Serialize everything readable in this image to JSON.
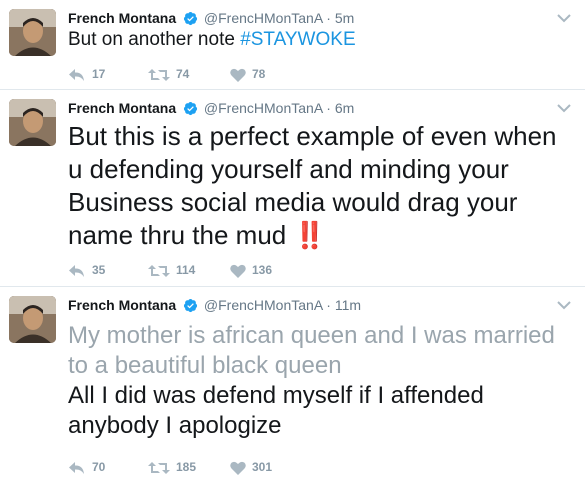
{
  "tweets": [
    {
      "name": "French Montana",
      "handle": "@FrencHMonTanA",
      "separator": "·",
      "time": "5m",
      "text_before": "But on another note ",
      "hashtag": "#STAYWOKE",
      "replies": "17",
      "retweets": "74",
      "likes": "78"
    },
    {
      "name": "French Montana",
      "handle": "@FrencHMonTanA",
      "separator": "·",
      "time": "6m",
      "text": "But this is a perfect example of even when u defending yourself and minding your Business social media would drag your name thru the mud ",
      "emoji": "‼️",
      "replies": "35",
      "retweets": "114",
      "likes": "136"
    },
    {
      "name": "French Montana",
      "handle": "@FrencHMonTanA",
      "separator": "·",
      "time": "11m",
      "text_faded": "My mother is african queen and I was married to a beautiful black queen",
      "text_main": "All I did was defend myself if I affended anybody I apologize",
      "replies": "70",
      "retweets": "185",
      "likes": "301"
    }
  ],
  "colors": {
    "link": "#1b95e0",
    "verified": "#1da1f2",
    "secondary": "#657786",
    "emoji": "#e0245e"
  },
  "icons": [
    "verified-badge-icon",
    "caret-down-icon",
    "reply-icon",
    "retweet-icon",
    "like-icon"
  ]
}
